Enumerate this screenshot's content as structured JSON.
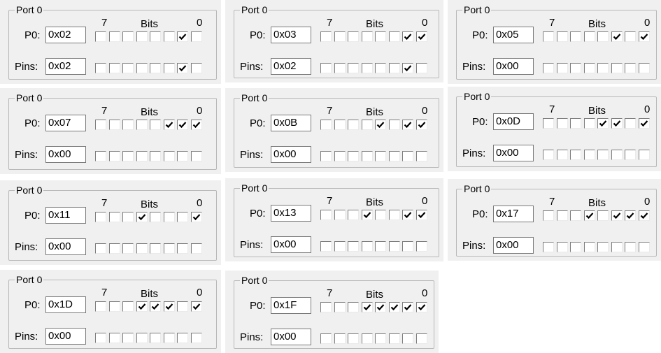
{
  "labels": {
    "port": "Port 0",
    "p0": "P0:",
    "pins": "Pins:",
    "bits": "Bits",
    "msb": "7",
    "lsb": "0"
  },
  "panels": [
    {
      "p0": "0x02",
      "pins": "0x02",
      "p0_bits": [
        0,
        0,
        0,
        0,
        0,
        0,
        1,
        0
      ],
      "pins_bits": [
        0,
        0,
        0,
        0,
        0,
        0,
        1,
        0
      ]
    },
    {
      "p0": "0x03",
      "pins": "0x02",
      "p0_bits": [
        0,
        0,
        0,
        0,
        0,
        0,
        1,
        1
      ],
      "pins_bits": [
        0,
        0,
        0,
        0,
        0,
        0,
        1,
        0
      ]
    },
    {
      "p0": "0x05",
      "pins": "0x00",
      "p0_bits": [
        0,
        0,
        0,
        0,
        0,
        1,
        0,
        1
      ],
      "pins_bits": [
        0,
        0,
        0,
        0,
        0,
        0,
        0,
        0
      ]
    },
    {
      "p0": "0x07",
      "pins": "0x00",
      "p0_bits": [
        0,
        0,
        0,
        0,
        0,
        1,
        1,
        1
      ],
      "pins_bits": [
        0,
        0,
        0,
        0,
        0,
        0,
        0,
        0
      ]
    },
    {
      "p0": "0x0B",
      "pins": "0x00",
      "p0_bits": [
        0,
        0,
        0,
        0,
        1,
        0,
        1,
        1
      ],
      "pins_bits": [
        0,
        0,
        0,
        0,
        0,
        0,
        0,
        0
      ]
    },
    {
      "p0": "0x0D",
      "pins": "0x00",
      "p0_bits": [
        0,
        0,
        0,
        0,
        1,
        1,
        0,
        1
      ],
      "pins_bits": [
        0,
        0,
        0,
        0,
        0,
        0,
        0,
        0
      ]
    },
    {
      "p0": "0x11",
      "pins": "0x00",
      "p0_bits": [
        0,
        0,
        0,
        1,
        0,
        0,
        0,
        1
      ],
      "pins_bits": [
        0,
        0,
        0,
        0,
        0,
        0,
        0,
        0
      ]
    },
    {
      "p0": "0x13",
      "pins": "0x00",
      "p0_bits": [
        0,
        0,
        0,
        1,
        0,
        0,
        1,
        1
      ],
      "pins_bits": [
        0,
        0,
        0,
        0,
        0,
        0,
        0,
        0
      ]
    },
    {
      "p0": "0x17",
      "pins": "0x00",
      "p0_bits": [
        0,
        0,
        0,
        1,
        0,
        1,
        1,
        1
      ],
      "pins_bits": [
        0,
        0,
        0,
        0,
        0,
        0,
        0,
        0
      ]
    },
    {
      "p0": "0x1D",
      "pins": "0x00",
      "p0_bits": [
        0,
        0,
        0,
        1,
        1,
        1,
        0,
        1
      ],
      "pins_bits": [
        0,
        0,
        0,
        0,
        0,
        0,
        0,
        0
      ]
    },
    {
      "p0": "0x1F",
      "pins": "0x00",
      "p0_bits": [
        0,
        0,
        0,
        1,
        1,
        1,
        1,
        1
      ],
      "pins_bits": [
        0,
        0,
        0,
        0,
        0,
        0,
        0,
        0
      ]
    }
  ]
}
